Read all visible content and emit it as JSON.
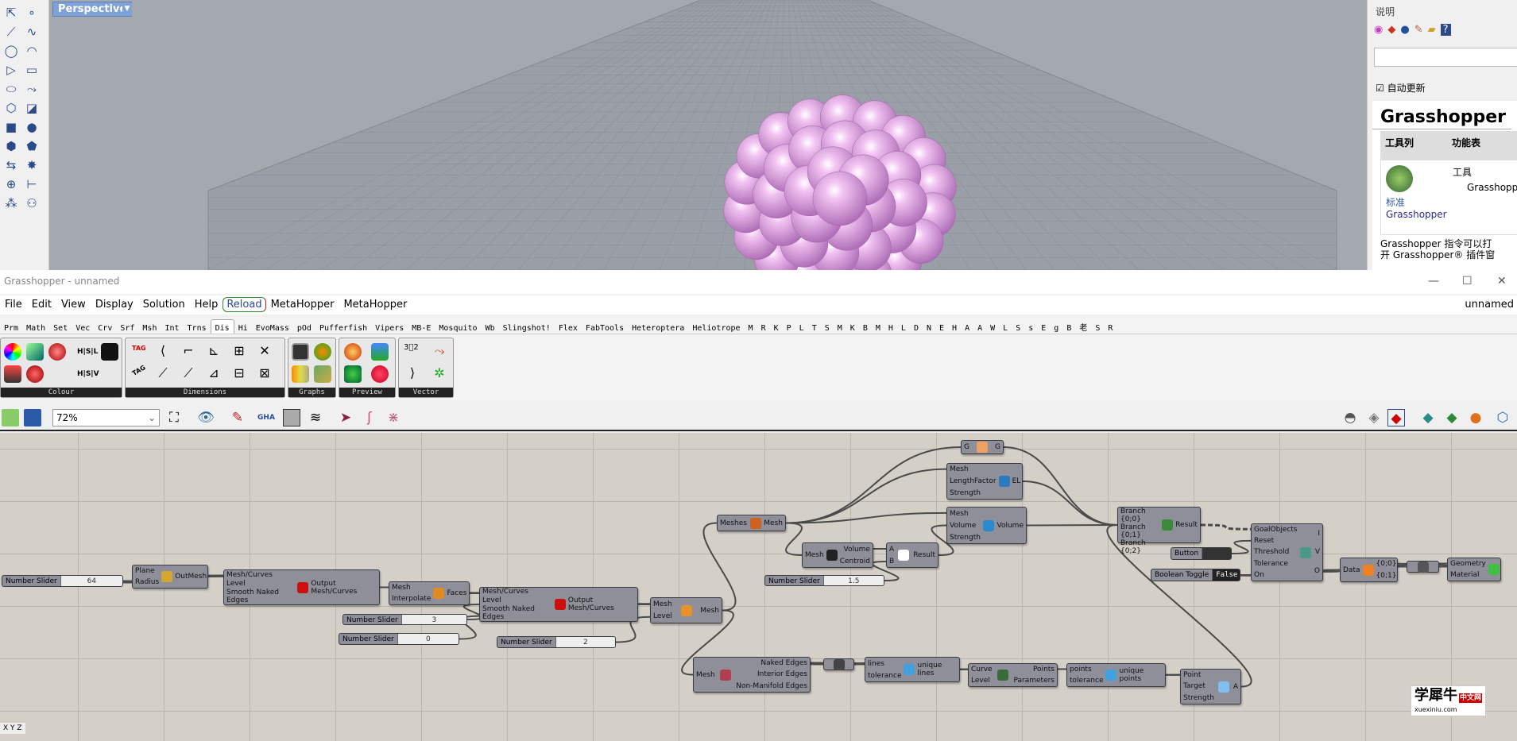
{
  "rhino": {
    "viewport_label": "Perspective",
    "left_tools": [
      "select-icon",
      "point-icon",
      "polyline-icon",
      "curve-icon",
      "circle-icon",
      "arc-icon",
      "polygon-icon",
      "rectangle-icon",
      "ellipse-icon",
      "freeform-icon",
      "surface-icon",
      "loft-icon",
      "box-icon",
      "sphere-icon",
      "cylinder-icon",
      "mesh-icon",
      "transform-icon",
      "explode-icon",
      "boolean-icon",
      "dimension-icon",
      "group-icon",
      "layers-icon"
    ],
    "right_panel": {
      "section_title": "说明",
      "tab_icons": [
        "color-wheel-icon",
        "material-icon",
        "render-icon",
        "light-icon",
        "folder-icon",
        "help-icon"
      ],
      "auto_update_label": "自动更新",
      "auto_update_checked": true,
      "help_title": "Grasshopper",
      "col_toolbar": "工具列",
      "col_menu": "功能表",
      "toolbar_link_1": "标准",
      "toolbar_link_2": "Grasshopper",
      "menu_item_1": "工具",
      "menu_item_2": "Grasshopper",
      "description": "Grasshopper 指令可以打开 Grasshopper® 插件窗"
    }
  },
  "gh": {
    "title": "Grasshopper - unnamed",
    "doc_name": "unnamed",
    "menu": [
      "File",
      "Edit",
      "View",
      "Display",
      "Solution",
      "Help",
      "Reload",
      "MetaHopper",
      "MetaHopper"
    ],
    "tabs": [
      "Prm",
      "Math",
      "Set",
      "Vec",
      "Crv",
      "Srf",
      "Msh",
      "Int",
      "Trns",
      "Dis",
      "Hi",
      "EvoMass",
      "pOd",
      "Pufferfish",
      "Vipers",
      "MB-E",
      "Mosquito",
      "Wb",
      "Slingshot!",
      "Flex",
      "FabTools",
      "Heteroptera",
      "Heliotrope",
      "M",
      "R",
      "K",
      "P",
      "L",
      "T",
      "S",
      "M",
      "K",
      "B",
      "M",
      "H",
      "L",
      "D",
      "N",
      "E",
      "H",
      "A",
      "A",
      "W",
      "L",
      "S",
      "s",
      "E",
      "g",
      "B",
      "老",
      "S",
      "R"
    ],
    "active_tab": "Dis",
    "ribbon_groups": [
      "Colour",
      "Dimensions",
      "Graphs",
      "Preview",
      "Vector"
    ],
    "ribbon_text": {
      "hsl": "H|S|L",
      "hsv": "H|S|V",
      "tag1": "TAG",
      "tag2": "TAG"
    },
    "zoom": "72%",
    "canvas_tools": [
      "open-icon",
      "save-icon",
      "zoom-extents-icon",
      "preview-eye-icon",
      "sketch-icon",
      "gha-icon",
      "canvas-icon",
      "wire-display-icon",
      "select-icon",
      "mouse-icon",
      "cluster-icon"
    ],
    "right_tools": [
      "shaded-icon",
      "wireframe-icon",
      "preview-selected-icon",
      "kangaroo-icon",
      "bake-icon",
      "render-icon",
      "sphere-preview-icon"
    ],
    "watermark": {
      "text": "学犀牛",
      "sub": "xuexiniu.com",
      "badge": "中文网"
    },
    "xyz": "X Y Z"
  },
  "canvas": {
    "nodes": [
      {
        "type": "slider",
        "label": "Number Slider",
        "value": "64"
      },
      {
        "inputs": [
          "Plane",
          "Radius"
        ],
        "outputs": [
          "OutMesh"
        ],
        "icon": "sphere-icon",
        "color": "#d4a830"
      },
      {
        "inputs": [
          "Mesh/Curves",
          "Level",
          "Smooth Naked Edges"
        ],
        "outputs": [
          "Output Mesh/Curves"
        ],
        "icon": "subdivide-icon",
        "color": "#cc1010"
      },
      {
        "inputs": [
          "Mesh",
          "Interpolate"
        ],
        "outputs": [
          "Faces"
        ],
        "icon": "faces-icon",
        "color": "#e08a20"
      },
      {
        "inputs": [
          "Mesh/Curves",
          "Level",
          "Smooth Naked Edges"
        ],
        "outputs": [
          "Output Mesh/Curves"
        ],
        "icon": "subdivide-icon",
        "color": "#cc1010"
      },
      {
        "type": "slider",
        "label": "Number Slider",
        "value": "3"
      },
      {
        "type": "slider",
        "label": "Number Slider",
        "value": "0"
      },
      {
        "type": "slider",
        "label": "Number Slider",
        "value": "2"
      },
      {
        "inputs": [
          "Mesh",
          "Level"
        ],
        "outputs": [
          "Mesh"
        ],
        "icon": "mesh-subdivide-icon",
        "color": "#e8902a"
      },
      {
        "inputs": [
          "Meshes"
        ],
        "outputs": [
          "Mesh"
        ],
        "icon": "mesh-join-icon",
        "color": "#d06020"
      },
      {
        "inputs": [
          "G"
        ],
        "outputs": [
          "G"
        ],
        "icon": "goal-icon",
        "color": "#f0a060"
      },
      {
        "inputs": [
          "Mesh",
          "LengthFactor",
          "Strength"
        ],
        "outputs": [
          "EL"
        ],
        "icon": "edge-length-icon",
        "color": "#2a7ac0"
      },
      {
        "inputs": [
          "Mesh",
          "Volume",
          "Strength"
        ],
        "outputs": [
          "Volume"
        ],
        "icon": "volume-icon",
        "color": "#2a8ad0"
      },
      {
        "inputs": [
          "Mesh"
        ],
        "outputs": [
          "Volume",
          "Centroid"
        ],
        "icon": "volume-m3-icon",
        "color": "#222"
      },
      {
        "inputs": [
          "A",
          "B"
        ],
        "outputs": [
          "Result"
        ],
        "icon": "multiply-icon",
        "color": "#fff"
      },
      {
        "type": "slider",
        "label": "Number Slider",
        "value": "1.5"
      },
      {
        "inputs": [
          "Branch {0;0}",
          "Branch {0;1}",
          "Branch {0;2}"
        ],
        "outputs": [
          "Result"
        ],
        "icon": "entwine-icon",
        "color": "#3a8a3a"
      },
      {
        "inputs": [
          "GoalObjects",
          "Reset",
          "Threshold",
          "Tolerance",
          "On"
        ],
        "outputs": [
          "I",
          "V",
          "O"
        ],
        "icon": "kangaroo-icon",
        "color": "#4a9a8a"
      },
      {
        "type": "button",
        "label": "Button"
      },
      {
        "type": "toggle",
        "label": "Boolean Toggle",
        "value": "False"
      },
      {
        "inputs": [
          "Data"
        ],
        "outputs": [
          "{0;0}",
          "{0;1}"
        ],
        "icon": "explode-tree-icon",
        "color": "#f08020"
      },
      {
        "inputs": [
          ""
        ],
        "outputs": [
          ""
        ],
        "icon": "flatten-icon",
        "color": "#555"
      },
      {
        "inputs": [
          "Geometry",
          "Material"
        ],
        "outputs": [],
        "icon": "custom-preview-icon",
        "color": "#40c040"
      },
      {
        "inputs": [
          "Mesh"
        ],
        "outputs": [
          "Naked Edges",
          "Interior Edges",
          "Non-Manifold Edges"
        ],
        "icon": "mesh-edges-icon",
        "color": "#b04050"
      },
      {
        "inputs": [
          ""
        ],
        "outputs": [
          ""
        ],
        "icon": "join-curves-icon",
        "color": "#444"
      },
      {
        "inputs": [
          "lines",
          "tolerance"
        ],
        "outputs": [
          "unique lines"
        ],
        "icon": "remove-duplicate-lines-icon",
        "color": "#40a0e0"
      },
      {
        "inputs": [
          "Curve",
          "Level"
        ],
        "outputs": [
          "Points",
          "Parameters"
        ],
        "icon": "control-points-icon",
        "color": "#3a6a3a"
      },
      {
        "inputs": [
          "points",
          "tolerance"
        ],
        "outputs": [
          "unique points"
        ],
        "icon": "remove-duplicate-points-icon",
        "color": "#40a0e0"
      },
      {
        "inputs": [
          "Point",
          "Target",
          "Strength"
        ],
        "outputs": [
          "A"
        ],
        "icon": "anchor-icon",
        "color": "#80c0f0"
      }
    ]
  },
  "colors": {
    "canvas": "#d4d0c8",
    "node": "#8e8f99",
    "viewport": "#a4a8af",
    "blob": "#e8a8e8",
    "vp_label": "#7fa1d6"
  }
}
